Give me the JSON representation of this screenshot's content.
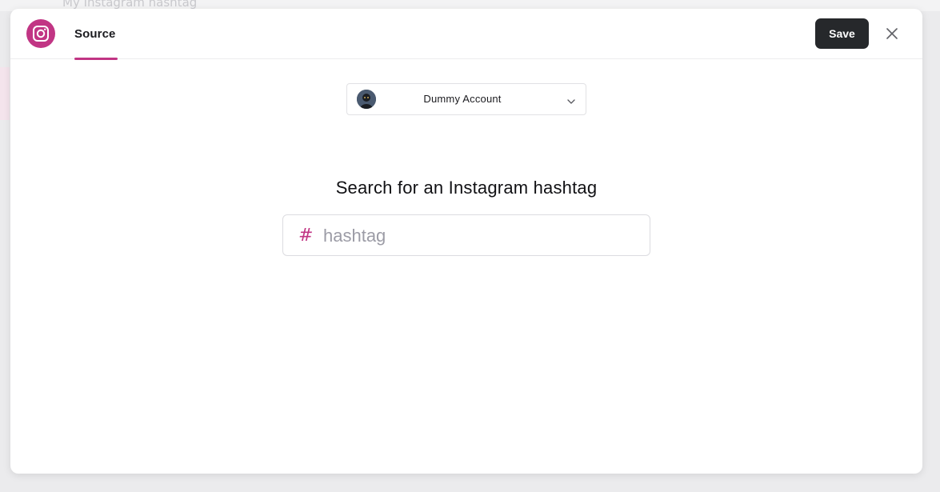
{
  "background": {
    "title": "My Instagram hashtag"
  },
  "header": {
    "logo_icon": "instagram-icon",
    "tab_label": "Source",
    "save_label": "Save",
    "close_icon": "close-icon"
  },
  "account_selector": {
    "selected": "Dummy Account",
    "chevron_icon": "chevron-down-icon"
  },
  "search": {
    "heading": "Search for an Instagram hashtag",
    "prefix": "#",
    "placeholder": "hashtag",
    "value": ""
  },
  "colors": {
    "accent": "#c13584",
    "button_dark": "#26282b",
    "placeholder": "#9c9ca6"
  }
}
